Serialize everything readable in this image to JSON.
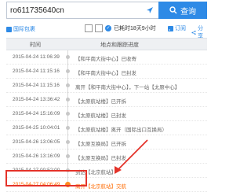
{
  "search": {
    "value": "ro611735640cn",
    "button_label": "查询"
  },
  "status": {
    "intl_tag": "国际包裹",
    "countdown_text": "已耗时18天9小时",
    "subscribe_label": "订阅",
    "share_label": "分享"
  },
  "table": {
    "col_time": "时间",
    "col_track": "地点和跟踪进度"
  },
  "rows": [
    {
      "time": "2015-04-24 11:06:39",
      "desc": "【和平南大街中心】已收寄"
    },
    {
      "time": "2015-04-24 11:15:16",
      "desc": "【和平南大街中心】已封发"
    },
    {
      "time": "2015-04-24 11:15:16",
      "desc": "离开【和平南大街中心】，下一站【太原中心】"
    },
    {
      "time": "2015-04-24 13:36:42",
      "desc": "【太原航站楼】已开拆"
    },
    {
      "time": "2015-04-24 15:16:09",
      "desc": "【太原航站楼】已封发"
    },
    {
      "time": "2015-04-25 10:04:01",
      "desc": "【太原航站楼】离开（国际出口互换局）"
    },
    {
      "time": "2015-04-26 13:06:05",
      "desc": "【太原互换局】已开拆"
    },
    {
      "time": "2015-04-26 13:16:09",
      "desc": "【太原互换局】已封发"
    },
    {
      "time": "2015-04-27 00:52:00",
      "desc": "到达【北京航站】"
    },
    {
      "time": "2015-04-27 04:06:49",
      "desc": "离开【北京航站】交航"
    }
  ],
  "colors": {
    "accent": "#2e8ae6",
    "highlight": "#ff6a00",
    "annotation": "#e4332a"
  }
}
